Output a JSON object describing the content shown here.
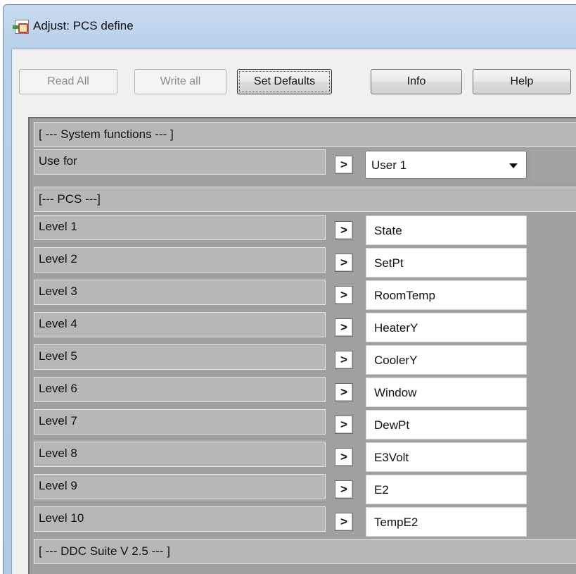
{
  "window": {
    "title": "Adjust: PCS define",
    "icon": "app-icon"
  },
  "toolbar": {
    "read_all": "Read All",
    "write_all": "Write all",
    "set_defaults": "Set Defaults",
    "info": "Info",
    "help": "Help"
  },
  "grid": {
    "system_section": "[ --- System functions --- ]",
    "use_for": {
      "label": "Use for",
      "arrow": ">",
      "value": "User 1"
    },
    "pcs_section": "[--- PCS ---]",
    "levels": [
      {
        "label": "Level 1",
        "arrow": ">",
        "value": "State"
      },
      {
        "label": "Level 2",
        "arrow": ">",
        "value": "SetPt"
      },
      {
        "label": "Level 3",
        "arrow": ">",
        "value": "RoomTemp"
      },
      {
        "label": "Level 4",
        "arrow": ">",
        "value": "HeaterY"
      },
      {
        "label": "Level 5",
        "arrow": ">",
        "value": "CoolerY"
      },
      {
        "label": "Level 6",
        "arrow": ">",
        "value": "Window"
      },
      {
        "label": "Level 7",
        "arrow": ">",
        "value": "DewPt"
      },
      {
        "label": "Level 8",
        "arrow": ">",
        "value": "E3Volt"
      },
      {
        "label": "Level 9",
        "arrow": ">",
        "value": "E2"
      },
      {
        "label": "Level 10",
        "arrow": ">",
        "value": "TempE2"
      }
    ],
    "ddc_section": "[ --- DDC Suite V 2.5 --- ]"
  }
}
